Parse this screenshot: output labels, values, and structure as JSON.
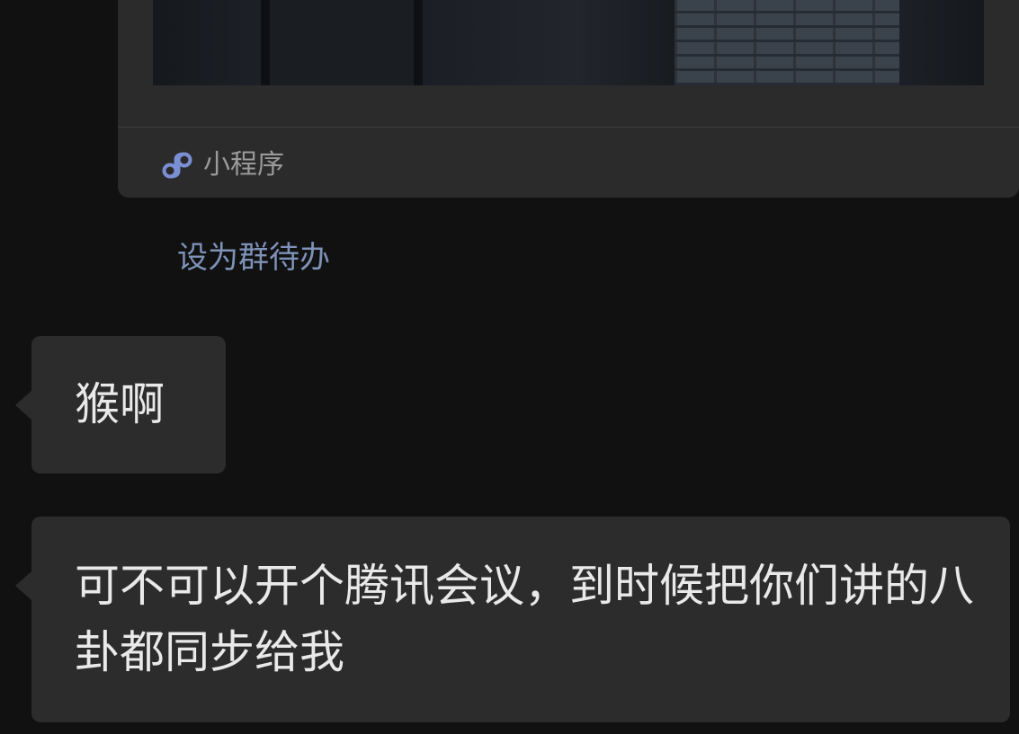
{
  "mini_program_card": {
    "label": "小程序",
    "icon": "mini-program-icon",
    "icon_color": "#7b8fd4"
  },
  "todo_link": {
    "label": "设为群待办",
    "color": "#7e92b8"
  },
  "messages": [
    {
      "text": "猴啊"
    },
    {
      "text": "可不可以开个腾讯会议，到时候把你们讲的八卦都同步给我"
    }
  ]
}
